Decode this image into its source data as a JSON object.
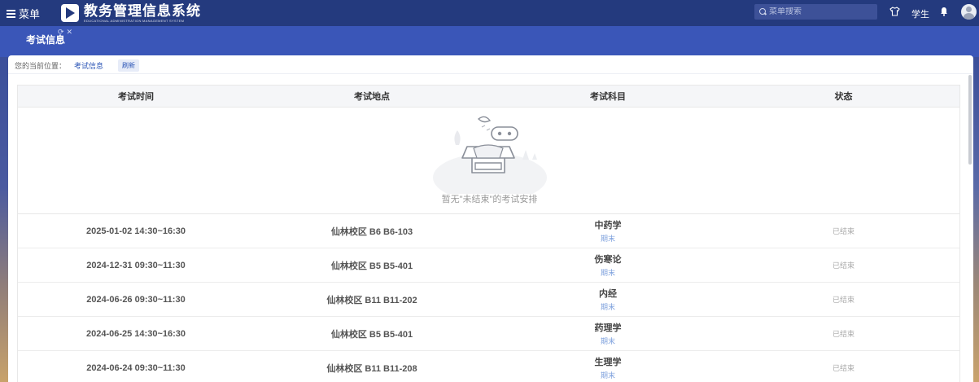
{
  "topbar": {
    "menu_label": "菜单",
    "app_title": "教务管理信息系统",
    "app_subtitle": "EDUCATIONAL ADMINISTRATION MANAGEMENT SYSTEM",
    "search_placeholder": "菜单搜索",
    "role_label": "学生",
    "icons": [
      "menu-icon",
      "logo-icon",
      "search-icon",
      "shirt-icon",
      "bell-icon",
      "avatar"
    ]
  },
  "tab": {
    "label": "考试信息"
  },
  "breadcrumb": {
    "prefix": "您的当前位置：",
    "current": "考试信息",
    "refresh_label": "刷新"
  },
  "table": {
    "headers": [
      "考试时间",
      "考试地点",
      "考试科目",
      "状态"
    ],
    "empty_text": "暂无\"未结束\"的考试安排",
    "rows": [
      {
        "time": "2025-01-02 14:30~16:30",
        "place": "仙林校区 B6 B6-103",
        "subject": "中药学",
        "type": "期末",
        "status": "已结束"
      },
      {
        "time": "2024-12-31 09:30~11:30",
        "place": "仙林校区 B5 B5-401",
        "subject": "伤寒论",
        "type": "期末",
        "status": "已结束"
      },
      {
        "time": "2024-06-26 09:30~11:30",
        "place": "仙林校区 B11 B11-202",
        "subject": "内经",
        "type": "期末",
        "status": "已结束"
      },
      {
        "time": "2024-06-25 14:30~16:30",
        "place": "仙林校区 B5 B5-401",
        "subject": "药理学",
        "type": "期末",
        "status": "已结束"
      },
      {
        "time": "2024-06-24 09:30~11:30",
        "place": "仙林校区 B11 B11-208",
        "subject": "生理学",
        "type": "期末",
        "status": "已结束"
      }
    ]
  },
  "colors": {
    "topbar": "#243a7e",
    "tabbar": "#3a56b8",
    "link": "#2b55b6",
    "exam_type": "#7da0dd",
    "status": "#aaaaaa"
  }
}
